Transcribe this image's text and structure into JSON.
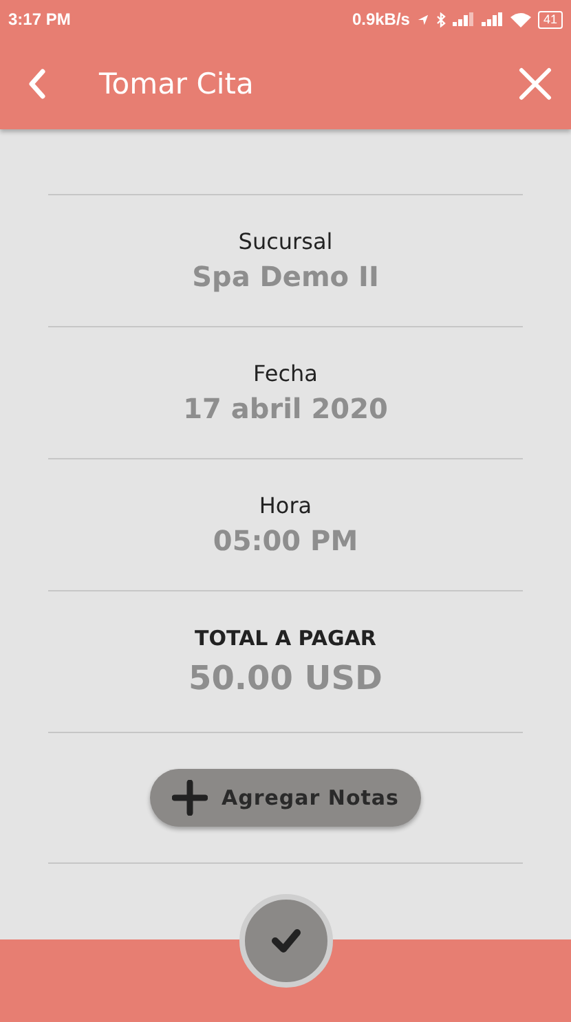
{
  "status_bar": {
    "time": "3:17 PM",
    "speed": "0.9kB/s",
    "battery": "41"
  },
  "header": {
    "title": "Tomar Cita"
  },
  "details": [
    {
      "kind": "info",
      "label": "Sucursal",
      "value": "Spa Demo II"
    },
    {
      "kind": "info",
      "label": "Fecha",
      "value": "17 abril 2020"
    },
    {
      "kind": "info",
      "label": "Hora",
      "value": "05:00 PM"
    },
    {
      "kind": "total",
      "label": "TOTAL A PAGAR",
      "value": "50.00 USD"
    }
  ],
  "notes_button": {
    "label": "Agregar Notas"
  }
}
